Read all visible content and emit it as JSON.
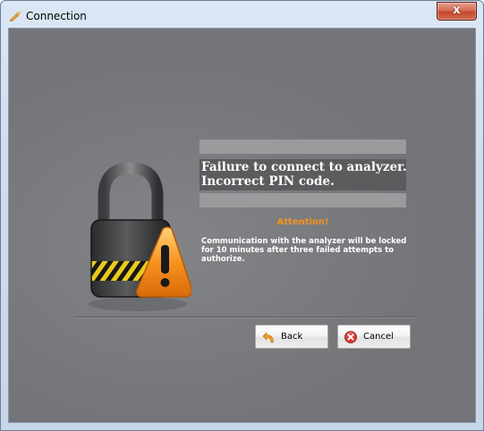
{
  "window": {
    "title": "Connection",
    "close_symbol": "x"
  },
  "error": {
    "heading_line1": "Failure to connect to analyzer.",
    "heading_line2": "Incorrect PIN code.",
    "attention": "Attention!",
    "message": "Communication with the analyzer will be locked for 10 minutes after three failed attempts to authorize."
  },
  "buttons": {
    "back": {
      "label": "Back",
      "icon": "back-arrow-icon"
    },
    "cancel": {
      "label": "Cancel",
      "icon": "cancel-x-icon"
    }
  },
  "colors": {
    "client_background": "#737578",
    "attention": "#f7931e",
    "heading_background": "#5b5c5e",
    "close_button": "#c44a2e"
  },
  "icons": {
    "app": "wrench-icon",
    "illustration": "padlock-warning-icon"
  }
}
